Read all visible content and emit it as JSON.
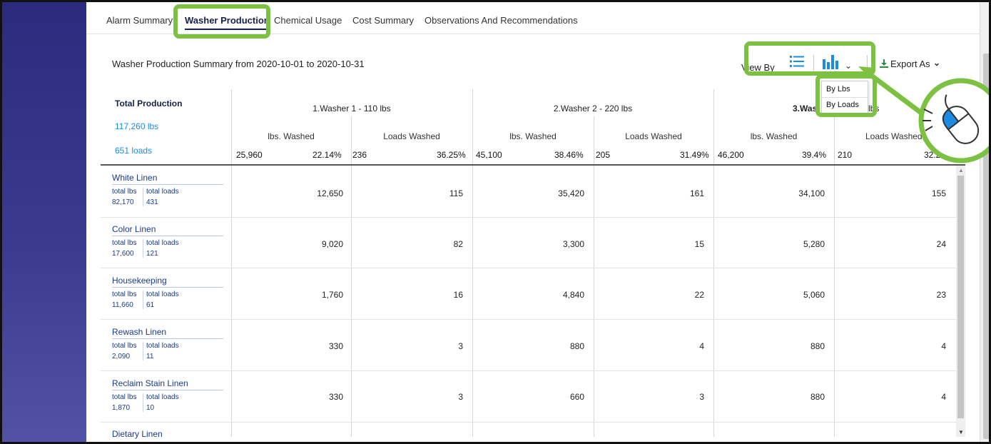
{
  "tabs": [
    {
      "label": "Alarm Summary"
    },
    {
      "label": "Washer Production"
    },
    {
      "label": "Chemical Usage"
    },
    {
      "label": "Cost Summary"
    },
    {
      "label": "Observations And Recommendations"
    }
  ],
  "summary_title": "Washer Production Summary from 2020-10-01 to 2020-10-31",
  "toolbar": {
    "view_by_label": "View By",
    "export_label": "Export As",
    "dropdown_options": [
      "By Lbs",
      "By Loads"
    ]
  },
  "totals": {
    "label": "Total Production",
    "lbs": "117,260 lbs",
    "loads": "651 loads"
  },
  "washers": [
    {
      "name": "1.Washer 1 - 110 lbs",
      "lbs_header": "lbs. Washed",
      "loads_header": "Loads Washed",
      "lbs_total": "25,960",
      "lbs_pct": "22.14%",
      "loads_total": "236",
      "loads_pct": "36.25%"
    },
    {
      "name": "2.Washer 2 - 220 lbs",
      "lbs_header": "lbs. Washed",
      "loads_header": "Loads Washed",
      "lbs_total": "45,100",
      "lbs_pct": "38.46%",
      "loads_total": "205",
      "loads_pct": "31.49%"
    },
    {
      "name": "3.Was",
      "name_tail": "lbs",
      "lbs_header": "lbs. Washed",
      "loads_header": "Loads Washed",
      "lbs_total": "46,200",
      "lbs_pct": "39.4%",
      "loads_total": "210",
      "loads_pct": "32.26%"
    }
  ],
  "rows": [
    {
      "name": "White Linen",
      "lbs_label": "total lbs",
      "loads_label": "total loads",
      "total_lbs": "82,170",
      "total_loads": "431",
      "values": [
        "12,650",
        "115",
        "35,420",
        "161",
        "34,100",
        "155"
      ]
    },
    {
      "name": "Color Linen",
      "lbs_label": "total lbs",
      "loads_label": "total loads",
      "total_lbs": "17,600",
      "total_loads": "121",
      "values": [
        "9,020",
        "82",
        "3,300",
        "15",
        "5,280",
        "24"
      ]
    },
    {
      "name": "Housekeeping",
      "lbs_label": "total lbs",
      "loads_label": "total loads",
      "total_lbs": "11,660",
      "total_loads": "61",
      "values": [
        "1,760",
        "16",
        "4,840",
        "22",
        "5,060",
        "23"
      ]
    },
    {
      "name": "Rewash Linen",
      "lbs_label": "total lbs",
      "loads_label": "total loads",
      "total_lbs": "2,090",
      "total_loads": "11",
      "values": [
        "330",
        "3",
        "880",
        "4",
        "880",
        "4"
      ]
    },
    {
      "name": "Reclaim Stain Linen",
      "lbs_label": "total lbs",
      "loads_label": "total loads",
      "total_lbs": "1,870",
      "total_loads": "10",
      "values": [
        "330",
        "3",
        "660",
        "3",
        "880",
        "4"
      ]
    },
    {
      "name": "Dietary Linen"
    }
  ],
  "colors": {
    "highlight": "#7cc142",
    "accent_blue": "#1a8ce6",
    "sidebar": "#2b2b7e"
  }
}
